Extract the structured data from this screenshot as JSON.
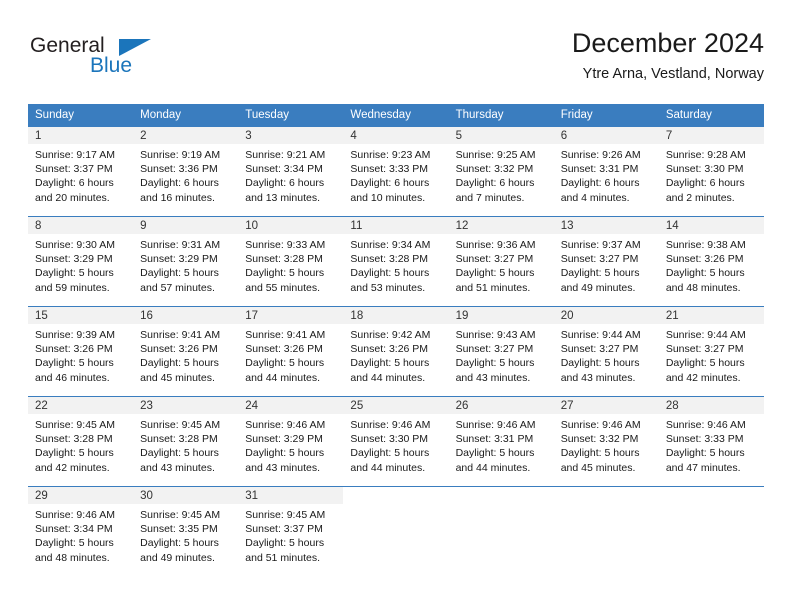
{
  "brand": {
    "name_top": "General",
    "name_bottom": "Blue",
    "accent_color": "#1b75bb",
    "triangle_icon": "triangle-icon"
  },
  "header": {
    "title": "December 2024",
    "subtitle": "Ytre Arna, Vestland, Norway"
  },
  "calendar": {
    "header_bg": "#3a7dbf",
    "header_text_color": "#ffffff",
    "daynum_band_bg": "#f2f2f2",
    "weekday_headers": [
      "Sunday",
      "Monday",
      "Tuesday",
      "Wednesday",
      "Thursday",
      "Friday",
      "Saturday"
    ],
    "weeks": [
      [
        {
          "day": "1",
          "sunrise": "Sunrise: 9:17 AM",
          "sunset": "Sunset: 3:37 PM",
          "daylight_line1": "Daylight: 6 hours",
          "daylight_line2": "and 20 minutes."
        },
        {
          "day": "2",
          "sunrise": "Sunrise: 9:19 AM",
          "sunset": "Sunset: 3:36 PM",
          "daylight_line1": "Daylight: 6 hours",
          "daylight_line2": "and 16 minutes."
        },
        {
          "day": "3",
          "sunrise": "Sunrise: 9:21 AM",
          "sunset": "Sunset: 3:34 PM",
          "daylight_line1": "Daylight: 6 hours",
          "daylight_line2": "and 13 minutes."
        },
        {
          "day": "4",
          "sunrise": "Sunrise: 9:23 AM",
          "sunset": "Sunset: 3:33 PM",
          "daylight_line1": "Daylight: 6 hours",
          "daylight_line2": "and 10 minutes."
        },
        {
          "day": "5",
          "sunrise": "Sunrise: 9:25 AM",
          "sunset": "Sunset: 3:32 PM",
          "daylight_line1": "Daylight: 6 hours",
          "daylight_line2": "and 7 minutes."
        },
        {
          "day": "6",
          "sunrise": "Sunrise: 9:26 AM",
          "sunset": "Sunset: 3:31 PM",
          "daylight_line1": "Daylight: 6 hours",
          "daylight_line2": "and 4 minutes."
        },
        {
          "day": "7",
          "sunrise": "Sunrise: 9:28 AM",
          "sunset": "Sunset: 3:30 PM",
          "daylight_line1": "Daylight: 6 hours",
          "daylight_line2": "and 2 minutes."
        }
      ],
      [
        {
          "day": "8",
          "sunrise": "Sunrise: 9:30 AM",
          "sunset": "Sunset: 3:29 PM",
          "daylight_line1": "Daylight: 5 hours",
          "daylight_line2": "and 59 minutes."
        },
        {
          "day": "9",
          "sunrise": "Sunrise: 9:31 AM",
          "sunset": "Sunset: 3:29 PM",
          "daylight_line1": "Daylight: 5 hours",
          "daylight_line2": "and 57 minutes."
        },
        {
          "day": "10",
          "sunrise": "Sunrise: 9:33 AM",
          "sunset": "Sunset: 3:28 PM",
          "daylight_line1": "Daylight: 5 hours",
          "daylight_line2": "and 55 minutes."
        },
        {
          "day": "11",
          "sunrise": "Sunrise: 9:34 AM",
          "sunset": "Sunset: 3:28 PM",
          "daylight_line1": "Daylight: 5 hours",
          "daylight_line2": "and 53 minutes."
        },
        {
          "day": "12",
          "sunrise": "Sunrise: 9:36 AM",
          "sunset": "Sunset: 3:27 PM",
          "daylight_line1": "Daylight: 5 hours",
          "daylight_line2": "and 51 minutes."
        },
        {
          "day": "13",
          "sunrise": "Sunrise: 9:37 AM",
          "sunset": "Sunset: 3:27 PM",
          "daylight_line1": "Daylight: 5 hours",
          "daylight_line2": "and 49 minutes."
        },
        {
          "day": "14",
          "sunrise": "Sunrise: 9:38 AM",
          "sunset": "Sunset: 3:26 PM",
          "daylight_line1": "Daylight: 5 hours",
          "daylight_line2": "and 48 minutes."
        }
      ],
      [
        {
          "day": "15",
          "sunrise": "Sunrise: 9:39 AM",
          "sunset": "Sunset: 3:26 PM",
          "daylight_line1": "Daylight: 5 hours",
          "daylight_line2": "and 46 minutes."
        },
        {
          "day": "16",
          "sunrise": "Sunrise: 9:41 AM",
          "sunset": "Sunset: 3:26 PM",
          "daylight_line1": "Daylight: 5 hours",
          "daylight_line2": "and 45 minutes."
        },
        {
          "day": "17",
          "sunrise": "Sunrise: 9:41 AM",
          "sunset": "Sunset: 3:26 PM",
          "daylight_line1": "Daylight: 5 hours",
          "daylight_line2": "and 44 minutes."
        },
        {
          "day": "18",
          "sunrise": "Sunrise: 9:42 AM",
          "sunset": "Sunset: 3:26 PM",
          "daylight_line1": "Daylight: 5 hours",
          "daylight_line2": "and 44 minutes."
        },
        {
          "day": "19",
          "sunrise": "Sunrise: 9:43 AM",
          "sunset": "Sunset: 3:27 PM",
          "daylight_line1": "Daylight: 5 hours",
          "daylight_line2": "and 43 minutes."
        },
        {
          "day": "20",
          "sunrise": "Sunrise: 9:44 AM",
          "sunset": "Sunset: 3:27 PM",
          "daylight_line1": "Daylight: 5 hours",
          "daylight_line2": "and 43 minutes."
        },
        {
          "day": "21",
          "sunrise": "Sunrise: 9:44 AM",
          "sunset": "Sunset: 3:27 PM",
          "daylight_line1": "Daylight: 5 hours",
          "daylight_line2": "and 42 minutes."
        }
      ],
      [
        {
          "day": "22",
          "sunrise": "Sunrise: 9:45 AM",
          "sunset": "Sunset: 3:28 PM",
          "daylight_line1": "Daylight: 5 hours",
          "daylight_line2": "and 42 minutes."
        },
        {
          "day": "23",
          "sunrise": "Sunrise: 9:45 AM",
          "sunset": "Sunset: 3:28 PM",
          "daylight_line1": "Daylight: 5 hours",
          "daylight_line2": "and 43 minutes."
        },
        {
          "day": "24",
          "sunrise": "Sunrise: 9:46 AM",
          "sunset": "Sunset: 3:29 PM",
          "daylight_line1": "Daylight: 5 hours",
          "daylight_line2": "and 43 minutes."
        },
        {
          "day": "25",
          "sunrise": "Sunrise: 9:46 AM",
          "sunset": "Sunset: 3:30 PM",
          "daylight_line1": "Daylight: 5 hours",
          "daylight_line2": "and 44 minutes."
        },
        {
          "day": "26",
          "sunrise": "Sunrise: 9:46 AM",
          "sunset": "Sunset: 3:31 PM",
          "daylight_line1": "Daylight: 5 hours",
          "daylight_line2": "and 44 minutes."
        },
        {
          "day": "27",
          "sunrise": "Sunrise: 9:46 AM",
          "sunset": "Sunset: 3:32 PM",
          "daylight_line1": "Daylight: 5 hours",
          "daylight_line2": "and 45 minutes."
        },
        {
          "day": "28",
          "sunrise": "Sunrise: 9:46 AM",
          "sunset": "Sunset: 3:33 PM",
          "daylight_line1": "Daylight: 5 hours",
          "daylight_line2": "and 47 minutes."
        }
      ],
      [
        {
          "day": "29",
          "sunrise": "Sunrise: 9:46 AM",
          "sunset": "Sunset: 3:34 PM",
          "daylight_line1": "Daylight: 5 hours",
          "daylight_line2": "and 48 minutes."
        },
        {
          "day": "30",
          "sunrise": "Sunrise: 9:45 AM",
          "sunset": "Sunset: 3:35 PM",
          "daylight_line1": "Daylight: 5 hours",
          "daylight_line2": "and 49 minutes."
        },
        {
          "day": "31",
          "sunrise": "Sunrise: 9:45 AM",
          "sunset": "Sunset: 3:37 PM",
          "daylight_line1": "Daylight: 5 hours",
          "daylight_line2": "and 51 minutes."
        },
        {
          "day": "",
          "sunrise": "",
          "sunset": "",
          "daylight_line1": "",
          "daylight_line2": ""
        },
        {
          "day": "",
          "sunrise": "",
          "sunset": "",
          "daylight_line1": "",
          "daylight_line2": ""
        },
        {
          "day": "",
          "sunrise": "",
          "sunset": "",
          "daylight_line1": "",
          "daylight_line2": ""
        },
        {
          "day": "",
          "sunrise": "",
          "sunset": "",
          "daylight_line1": "",
          "daylight_line2": ""
        }
      ]
    ]
  }
}
